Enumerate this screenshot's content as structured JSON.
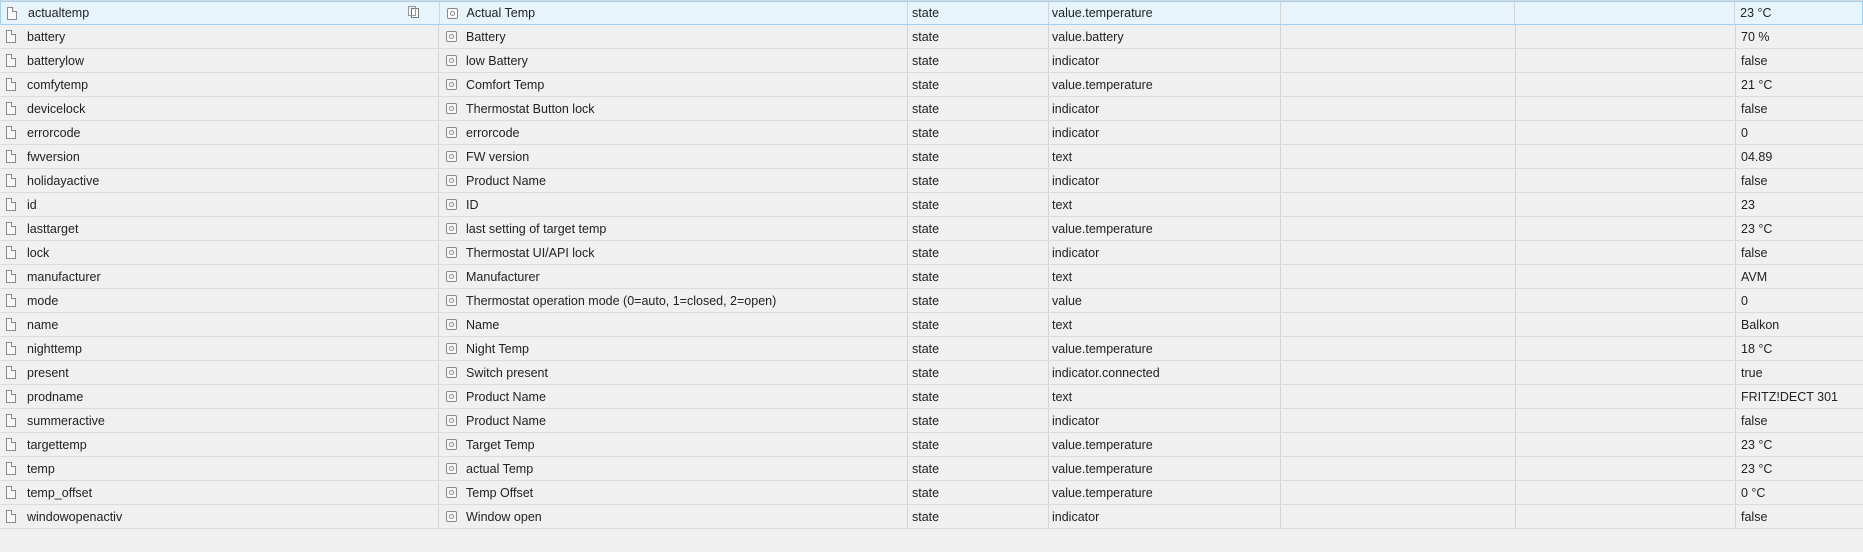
{
  "rows": [
    {
      "id": "actualtemp",
      "name": "Actual Temp",
      "type": "state",
      "role": "value.temperature",
      "room": "",
      "function": "",
      "value": "23 °C"
    },
    {
      "id": "battery",
      "name": "Battery",
      "type": "state",
      "role": "value.battery",
      "room": "",
      "function": "",
      "value": "70 %"
    },
    {
      "id": "batterylow",
      "name": "low Battery",
      "type": "state",
      "role": "indicator",
      "room": "",
      "function": "",
      "value": "false"
    },
    {
      "id": "comfytemp",
      "name": "Comfort Temp",
      "type": "state",
      "role": "value.temperature",
      "room": "",
      "function": "",
      "value": "21 °C"
    },
    {
      "id": "devicelock",
      "name": "Thermostat Button lock",
      "type": "state",
      "role": "indicator",
      "room": "",
      "function": "",
      "value": "false"
    },
    {
      "id": "errorcode",
      "name": "errorcode",
      "type": "state",
      "role": "indicator",
      "room": "",
      "function": "",
      "value": "0"
    },
    {
      "id": "fwversion",
      "name": "FW version",
      "type": "state",
      "role": "text",
      "room": "",
      "function": "",
      "value": "04.89"
    },
    {
      "id": "holidayactive",
      "name": "Product Name",
      "type": "state",
      "role": "indicator",
      "room": "",
      "function": "",
      "value": "false"
    },
    {
      "id": "id",
      "name": "ID",
      "type": "state",
      "role": "text",
      "room": "",
      "function": "",
      "value": "23"
    },
    {
      "id": "lasttarget",
      "name": "last setting of target temp",
      "type": "state",
      "role": "value.temperature",
      "room": "",
      "function": "",
      "value": "23 °C"
    },
    {
      "id": "lock",
      "name": "Thermostat UI/API lock",
      "type": "state",
      "role": "indicator",
      "room": "",
      "function": "",
      "value": "false"
    },
    {
      "id": "manufacturer",
      "name": "Manufacturer",
      "type": "state",
      "role": "text",
      "room": "",
      "function": "",
      "value": "AVM"
    },
    {
      "id": "mode",
      "name": "Thermostat operation mode (0=auto, 1=closed, 2=open)",
      "type": "state",
      "role": "value",
      "room": "",
      "function": "",
      "value": "0"
    },
    {
      "id": "name",
      "name": "Name",
      "type": "state",
      "role": "text",
      "room": "",
      "function": "",
      "value": "Balkon"
    },
    {
      "id": "nighttemp",
      "name": "Night Temp",
      "type": "state",
      "role": "value.temperature",
      "room": "",
      "function": "",
      "value": "18 °C"
    },
    {
      "id": "present",
      "name": "Switch present",
      "type": "state",
      "role": "indicator.connected",
      "room": "",
      "function": "",
      "value": "true"
    },
    {
      "id": "prodname",
      "name": "Product Name",
      "type": "state",
      "role": "text",
      "room": "",
      "function": "",
      "value": "FRITZ!DECT 301"
    },
    {
      "id": "summeractive",
      "name": "Product Name",
      "type": "state",
      "role": "indicator",
      "room": "",
      "function": "",
      "value": "false"
    },
    {
      "id": "targettemp",
      "name": "Target Temp",
      "type": "state",
      "role": "value.temperature",
      "room": "",
      "function": "",
      "value": "23 °C"
    },
    {
      "id": "temp",
      "name": "actual Temp",
      "type": "state",
      "role": "value.temperature",
      "room": "",
      "function": "",
      "value": "23 °C"
    },
    {
      "id": "temp_offset",
      "name": "Temp Offset",
      "type": "state",
      "role": "value.temperature",
      "room": "",
      "function": "",
      "value": "0 °C"
    },
    {
      "id": "windowopenactiv",
      "name": "Window open",
      "type": "state",
      "role": "indicator",
      "room": "",
      "function": "",
      "value": "false"
    }
  ],
  "icons": {
    "object": "file-icon",
    "state": "state-icon",
    "copy": "copy-icon"
  },
  "colors": {
    "selected_row_bg": "#e8f4fc",
    "selected_row_border": "#9fd2f5"
  }
}
